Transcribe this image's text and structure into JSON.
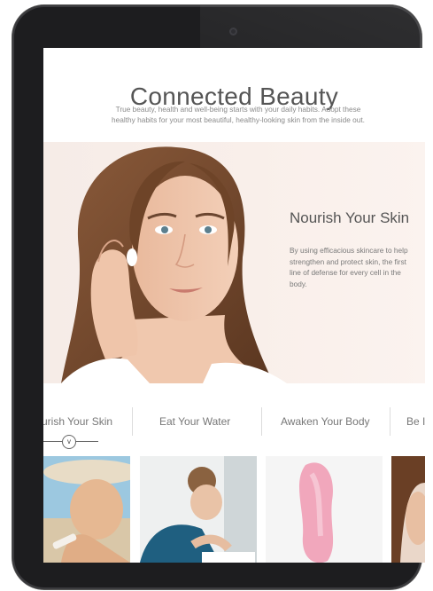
{
  "page": {
    "title": "Connected Beauty",
    "intro_line1": "True beauty, health and well-being starts with your daily habits. Adopt these",
    "intro_line2": "healthy habits for your most beautiful, healthy-looking skin from the inside out."
  },
  "hero": {
    "title": "Nourish Your Skin",
    "body": "By using efficacious skincare to help strengthen and protect skin, the first line of defense for every cell in the body."
  },
  "tabs": [
    {
      "label": "urish Your Skin"
    },
    {
      "label": "Eat Your Water"
    },
    {
      "label": "Awaken Your Body"
    },
    {
      "label": "Be I"
    }
  ],
  "carousel": {
    "knob_glyph": "v",
    "progress": 0.14
  },
  "thumbnails": [
    {
      "subject": "woman-in-sun-hat-at-beach"
    },
    {
      "subject": "woman-washing-face"
    },
    {
      "subject": "pink-cream-swatch"
    },
    {
      "subject": "woman-portrait-partial"
    }
  ],
  "colors": {
    "frame": "#1d1d1f",
    "hero_bg": "#f6ece7",
    "heading": "#555555",
    "body_text": "#7a7a7a"
  }
}
